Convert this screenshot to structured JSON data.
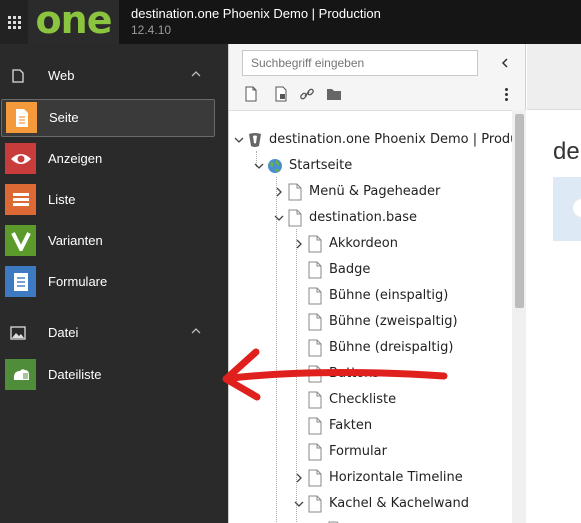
{
  "app": {
    "logo_text": "one",
    "site_title": "destination.one Phoenix Demo | Production",
    "version": "12.4.10"
  },
  "module_menu": {
    "groups": [
      {
        "label": "Web",
        "icon": "web-folder-icon",
        "items": [
          {
            "label": "Seite",
            "icon": "page-icon",
            "color": "#f49a3b",
            "active": true
          },
          {
            "label": "Anzeigen",
            "icon": "eye-icon",
            "color": "#c83c3c"
          },
          {
            "label": "Liste",
            "icon": "list-icon",
            "color": "#dd6a34"
          },
          {
            "label": "Varianten",
            "icon": "v-letter-icon",
            "color": "#5c9a2c"
          },
          {
            "label": "Formulare",
            "icon": "form-icon",
            "color": "#3e7ac2"
          }
        ]
      },
      {
        "label": "Datei",
        "icon": "image-icon",
        "items": [
          {
            "label": "Dateiliste",
            "icon": "filelist-icon",
            "color": "#4f8d3a"
          }
        ]
      }
    ]
  },
  "page_tree": {
    "search_placeholder": "Suchbegriff eingeben",
    "toolbar_icons": [
      "new-page-icon",
      "paste-page-icon",
      "link-icon",
      "folder-icon"
    ],
    "root": "destination.one Phoenix Demo | Production",
    "nodes": [
      {
        "label": "Startseite",
        "icon": "globe-icon"
      },
      {
        "label": "Menü & Pageheader"
      },
      {
        "label": "destination.base"
      },
      {
        "label": "Akkordeon"
      },
      {
        "label": "Badge"
      },
      {
        "label": "Bühne (einspaltig)"
      },
      {
        "label": "Bühne (zweispaltig)"
      },
      {
        "label": "Bühne (dreispaltig)"
      },
      {
        "label": "Buttons"
      },
      {
        "label": "Checkliste"
      },
      {
        "label": "Fakten"
      },
      {
        "label": "Formular"
      },
      {
        "label": "Horizontale Timeline"
      },
      {
        "label": "Kachel & Kachelwand"
      }
    ]
  },
  "content": {
    "heading": "de"
  },
  "colors": {
    "topbar": "#151515",
    "menu_bg": "#2a2a2a",
    "logo_green": "#8bc53f",
    "arrow_red": "#e0201c"
  },
  "annotation": {
    "icon": "red-arrow-icon"
  }
}
